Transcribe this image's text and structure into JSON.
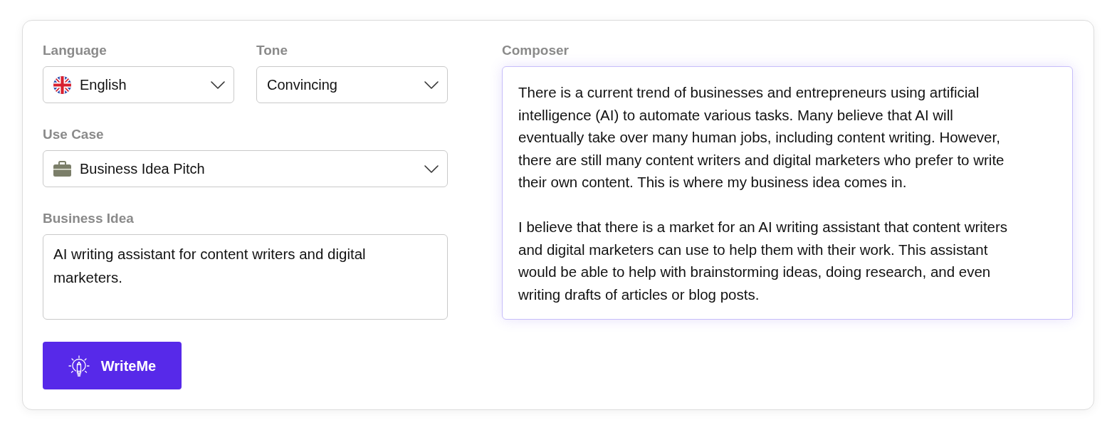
{
  "language": {
    "label": "Language",
    "value": "English"
  },
  "tone": {
    "label": "Tone",
    "value": "Convincing"
  },
  "use_case": {
    "label": "Use Case",
    "value": "Business Idea Pitch"
  },
  "business_idea": {
    "label": "Business Idea",
    "value": "AI writing assistant for content writers and digital marketers."
  },
  "button": {
    "label": "WriteMe"
  },
  "composer": {
    "label": "Composer",
    "paragraphs": [
      "There is a current trend of businesses and entrepreneurs using artificial intelligence (AI) to automate various tasks. Many believe that AI will eventually take over many human jobs, including content writing. However, there are still many content writers and digital marketers who prefer to write their own content. This is where my business idea comes in.",
      "I believe that there is a market for an AI writing assistant that content writers and digital marketers can use to help them with their work. This assistant would be able to help with brainstorming ideas, doing research, and even writing drafts of articles or blog posts."
    ]
  }
}
